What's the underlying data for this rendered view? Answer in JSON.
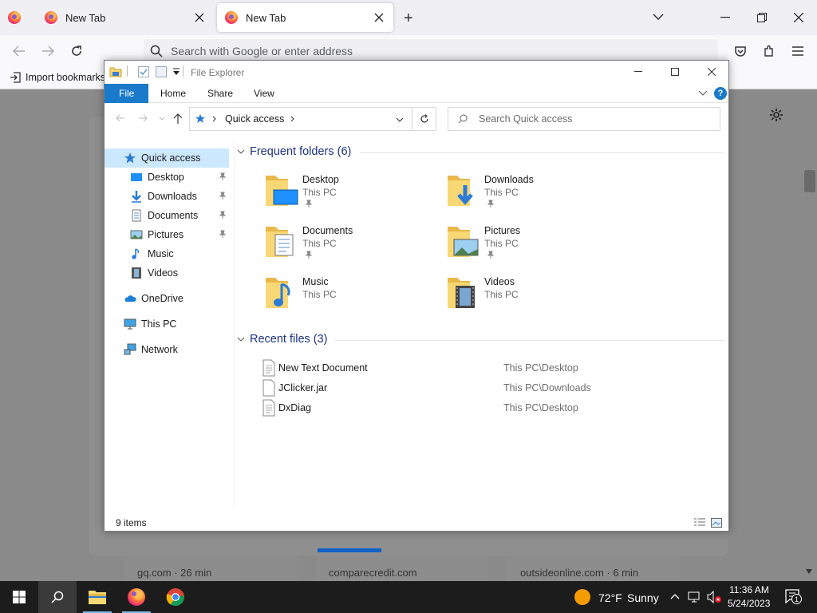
{
  "firefox": {
    "tabs": [
      {
        "label": "New Tab"
      },
      {
        "label": "New Tab"
      }
    ],
    "new_tab_symbol": "+",
    "url_placeholder": "Search with Google or enter address",
    "bookmark_import": "Import bookmarks",
    "shortcuts": [
      {
        "label": "gq.com · 26 min"
      },
      {
        "label": "comparecredit.com"
      },
      {
        "label": "outsideonline.com · 6 min"
      }
    ]
  },
  "explorer": {
    "title": "File Explorer",
    "ribbon_tabs": [
      "File",
      "Home",
      "Share",
      "View"
    ],
    "address": "Quick access",
    "search_placeholder": "Search Quick access",
    "nav": [
      {
        "label": "Quick access",
        "icon": "star-icon"
      },
      {
        "label": "Desktop",
        "icon": "desktop-icon",
        "pinned": true
      },
      {
        "label": "Downloads",
        "icon": "download-icon",
        "pinned": true
      },
      {
        "label": "Documents",
        "icon": "document-icon",
        "pinned": true
      },
      {
        "label": "Pictures",
        "icon": "picture-icon",
        "pinned": true
      },
      {
        "label": "Music",
        "icon": "music-icon"
      },
      {
        "label": "Videos",
        "icon": "video-icon"
      },
      {
        "label": "OneDrive",
        "icon": "cloud-icon"
      },
      {
        "label": "This PC",
        "icon": "pc-icon"
      },
      {
        "label": "Network",
        "icon": "network-icon"
      }
    ],
    "frequent_header": "Frequent folders (6)",
    "folders": [
      {
        "name": "Desktop",
        "location": "This PC",
        "pinned": true
      },
      {
        "name": "Downloads",
        "location": "This PC",
        "pinned": true
      },
      {
        "name": "Documents",
        "location": "This PC",
        "pinned": true
      },
      {
        "name": "Pictures",
        "location": "This PC",
        "pinned": true
      },
      {
        "name": "Music",
        "location": "This PC",
        "pinned": false
      },
      {
        "name": "Videos",
        "location": "This PC",
        "pinned": false
      }
    ],
    "recent_header": "Recent files (3)",
    "recent": [
      {
        "name": "New Text Document",
        "path": "This PC\\Desktop"
      },
      {
        "name": "JClicker.jar",
        "path": "This PC\\Downloads"
      },
      {
        "name": "DxDiag",
        "path": "This PC\\Desktop"
      }
    ],
    "status": "9 items"
  },
  "taskbar": {
    "weather_temp": "72°F",
    "weather_text": "Sunny",
    "time": "11:36 AM",
    "date": "5/24/2023",
    "notification_count": "1"
  },
  "colors": {
    "accent": "#1979ca",
    "selection": "#cce8ff",
    "folder": "#f8d775",
    "taskbar": "#1c1c1c"
  }
}
